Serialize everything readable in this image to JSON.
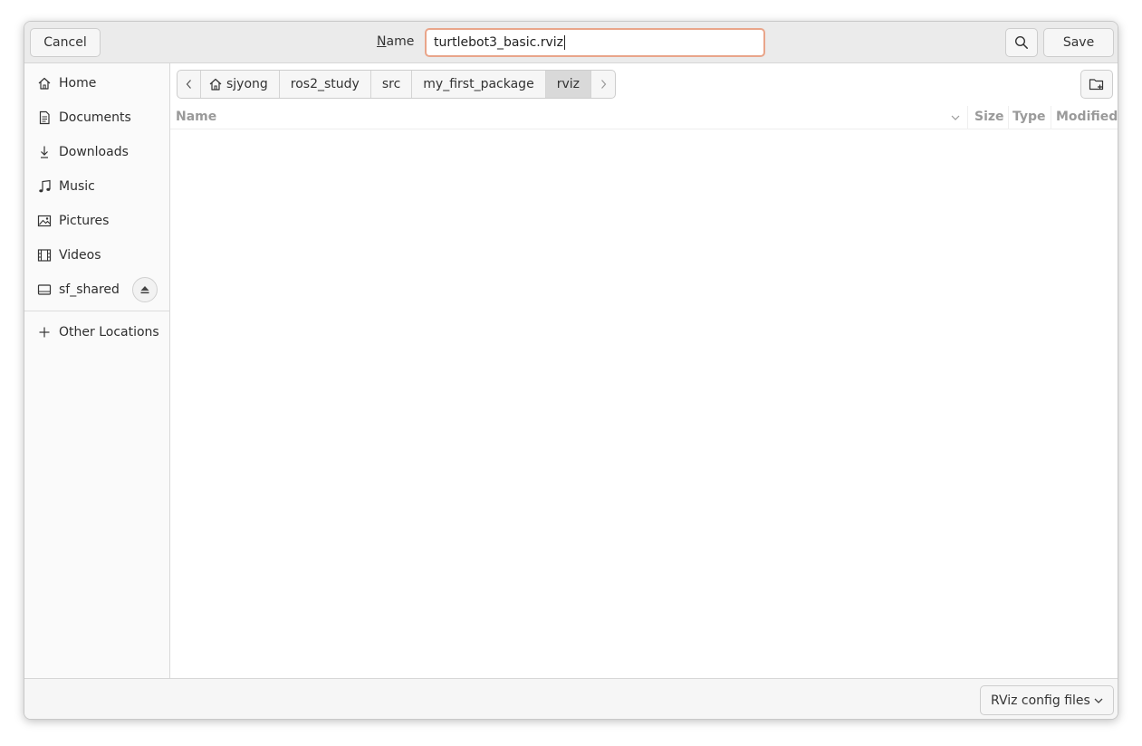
{
  "header": {
    "cancel_label": "Cancel",
    "name_label_mnemonic": "N",
    "name_label_rest": "ame",
    "filename": "turtlebot3_basic.rviz",
    "save_label": "Save"
  },
  "sidebar": {
    "items": [
      {
        "label": "Home",
        "icon": "home-icon"
      },
      {
        "label": "Documents",
        "icon": "document-icon"
      },
      {
        "label": "Downloads",
        "icon": "download-icon"
      },
      {
        "label": "Music",
        "icon": "music-icon"
      },
      {
        "label": "Pictures",
        "icon": "picture-icon"
      },
      {
        "label": "Videos",
        "icon": "video-icon"
      },
      {
        "label": "sf_shared",
        "icon": "drive-icon"
      }
    ],
    "other_locations": "Other Locations"
  },
  "pathbar": {
    "crumbs": [
      "sjyong",
      "ros2_study",
      "src",
      "my_first_package",
      "rviz"
    ],
    "active": "rviz"
  },
  "columns": {
    "name": "Name",
    "size": "Size",
    "type": "Type",
    "modified": "Modified"
  },
  "footer": {
    "filter": "RViz config files"
  },
  "colors": {
    "input_focus_border": "#e9a58a",
    "headerbar_bg": "#ebebeb",
    "sidebar_bg": "#fafafa"
  }
}
